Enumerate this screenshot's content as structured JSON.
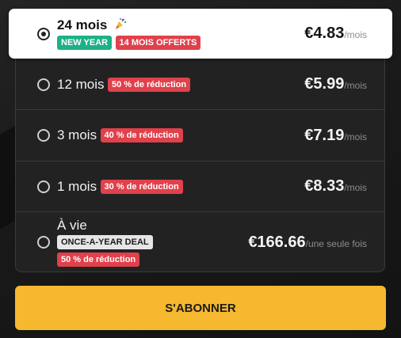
{
  "plans": [
    {
      "name": "24 mois",
      "badges": [
        "NEW YEAR",
        "14 MOIS OFFERTS"
      ],
      "price": "€4.83",
      "per": "/mois",
      "selected": true
    },
    {
      "name": "12 mois",
      "badges": [
        "50 % de réduction"
      ],
      "price": "€5.99",
      "per": "/mois",
      "selected": false
    },
    {
      "name": "3 mois",
      "badges": [
        "40 % de réduction"
      ],
      "price": "€7.19",
      "per": "/mois",
      "selected": false
    },
    {
      "name": "1 mois",
      "badges": [
        "30 % de réduction"
      ],
      "price": "€8.33",
      "per": "/mois",
      "selected": false
    },
    {
      "name": "À vie",
      "badges": [
        "ONCE-A-YEAR DEAL",
        "50 % de réduction"
      ],
      "price": "€166.66",
      "per": "/une seule fois",
      "selected": false
    }
  ],
  "subscribe_label": "S'ABONNER",
  "colors": {
    "accent": "#f5b82e",
    "badge_red": "#e0414b",
    "badge_green": "#1db188",
    "panel": "#222223"
  },
  "icons": {
    "party": "party-popper-icon"
  }
}
